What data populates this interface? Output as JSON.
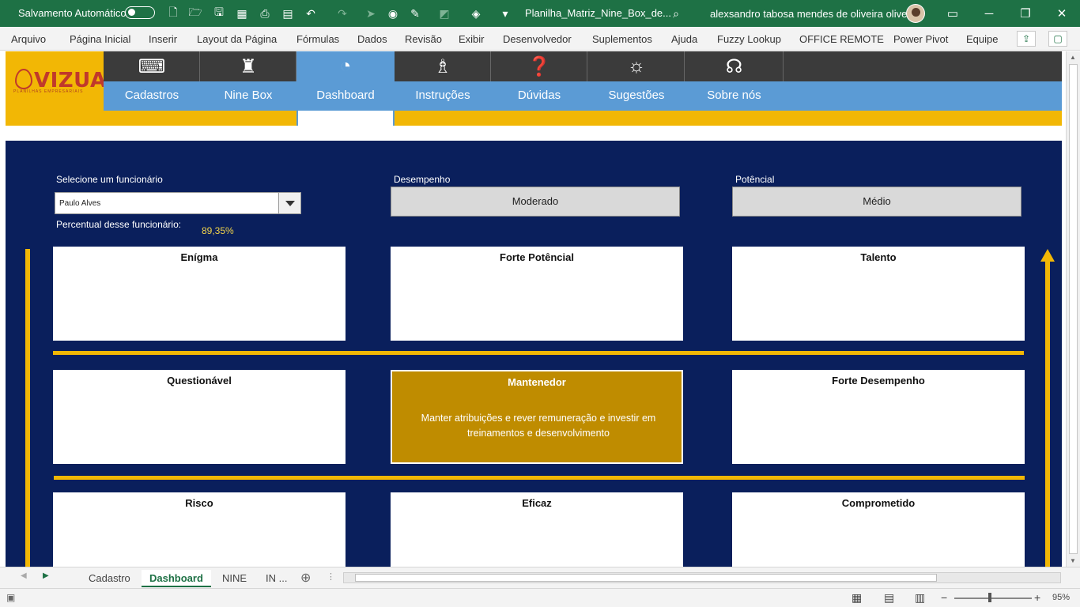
{
  "titlebar": {
    "autosave_label": "Salvamento Automático",
    "doc_title": "Planilha_Matriz_Nine_Box_de...",
    "user_name": "alexsandro tabosa mendes de oliveira oliveira"
  },
  "ribbon": {
    "tabs": [
      "Arquivo",
      "Página Inicial",
      "Inserir",
      "Layout da Página",
      "Fórmulas",
      "Dados",
      "Revisão",
      "Exibir",
      "Desenvolvedor",
      "Suplementos",
      "Ajuda",
      "Fuzzy Lookup",
      "OFFICE REMOTE",
      "Power Pivot",
      "Equipe"
    ]
  },
  "logo": {
    "name": "VIZUAL",
    "tagline": "PLANILHAS EMPRESARIAIS"
  },
  "nav": {
    "items": [
      {
        "label": "Cadastros",
        "icon": "typewriter-icon"
      },
      {
        "label": "Nine Box",
        "icon": "chess-icon"
      },
      {
        "label": "Dashboard",
        "icon": "pie-chart-icon"
      },
      {
        "label": "Instruções",
        "icon": "presentation-icon"
      },
      {
        "label": "Dúvidas",
        "icon": "question-person-icon"
      },
      {
        "label": "Sugestões",
        "icon": "lightbulb-icon"
      },
      {
        "label": "Sobre nós",
        "icon": "owl-icon"
      }
    ],
    "active": "Dashboard"
  },
  "dashboard": {
    "select_label": "Selecione um  funcionário",
    "selected_employee": "Paulo Alves",
    "percent_label": "Percentual desse funcionário:",
    "percent_value": "89,35%",
    "desempenho_label": "Desempenho",
    "desempenho_value": "Moderado",
    "potencial_label": "Potêncial",
    "potencial_value": "Médio",
    "grid": [
      {
        "title": "Enígma",
        "desc": ""
      },
      {
        "title": "Forte Potêncial",
        "desc": ""
      },
      {
        "title": "Talento",
        "desc": ""
      },
      {
        "title": "Questionável",
        "desc": ""
      },
      {
        "title": "Mantenedor",
        "desc": "Manter atribuições e rever remuneração e investir em treinamentos e desenvolvimento",
        "highlighted": true
      },
      {
        "title": "Forte Desempenho",
        "desc": ""
      },
      {
        "title": "Risco",
        "desc": ""
      },
      {
        "title": "Eficaz",
        "desc": ""
      },
      {
        "title": "Comprometido",
        "desc": ""
      }
    ],
    "colors": {
      "panel": "#0a1f5c",
      "accent": "#f2b705",
      "highlight": "#bf8c00",
      "nav_light": "#5b9bd5",
      "nav_dark": "#3b3b3b"
    }
  },
  "sheet_tabs": {
    "tabs": [
      "Cadastro",
      "Dashboard",
      "NINE",
      "IN ..."
    ],
    "active": "Dashboard"
  },
  "statusbar": {
    "zoom": "95%"
  }
}
